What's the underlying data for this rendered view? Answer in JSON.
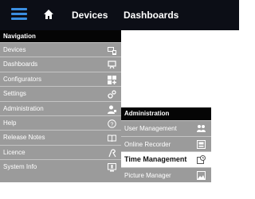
{
  "topbar": {
    "menu_icon": "hamburger-menu-icon",
    "home_icon": "home-icon",
    "links": [
      "Devices",
      "Dashboards"
    ]
  },
  "navigation": {
    "header": "Navigation",
    "items": [
      {
        "label": "Devices",
        "icon": "devices-icon"
      },
      {
        "label": "Dashboards",
        "icon": "dashboard-icon"
      },
      {
        "label": "Configurators",
        "icon": "configurators-icon"
      },
      {
        "label": "Settings",
        "icon": "gear-icon"
      },
      {
        "label": "Administration",
        "icon": "admin-user-icon"
      },
      {
        "label": "Help",
        "icon": "help-icon"
      },
      {
        "label": "Release Notes",
        "icon": "book-icon"
      },
      {
        "label": "Licence",
        "icon": "licence-icon"
      },
      {
        "label": "System Info",
        "icon": "system-info-icon"
      }
    ]
  },
  "administration_submenu": {
    "header": "Administration",
    "items": [
      {
        "label": "User Management",
        "icon": "users-icon"
      },
      {
        "label": "Online Recorder",
        "icon": "recorder-icon"
      },
      {
        "label": "Time Management",
        "icon": "time-management-icon"
      },
      {
        "label": "Picture Manager",
        "icon": "picture-icon"
      }
    ],
    "selected": "Time Management"
  },
  "colors": {
    "topbar_bg": "#0c0e16",
    "panel_bg": "#9b9b9b",
    "header_bg": "#050505",
    "accent_blue": "#3b8ee0",
    "selected_bg": "#ffffff"
  }
}
